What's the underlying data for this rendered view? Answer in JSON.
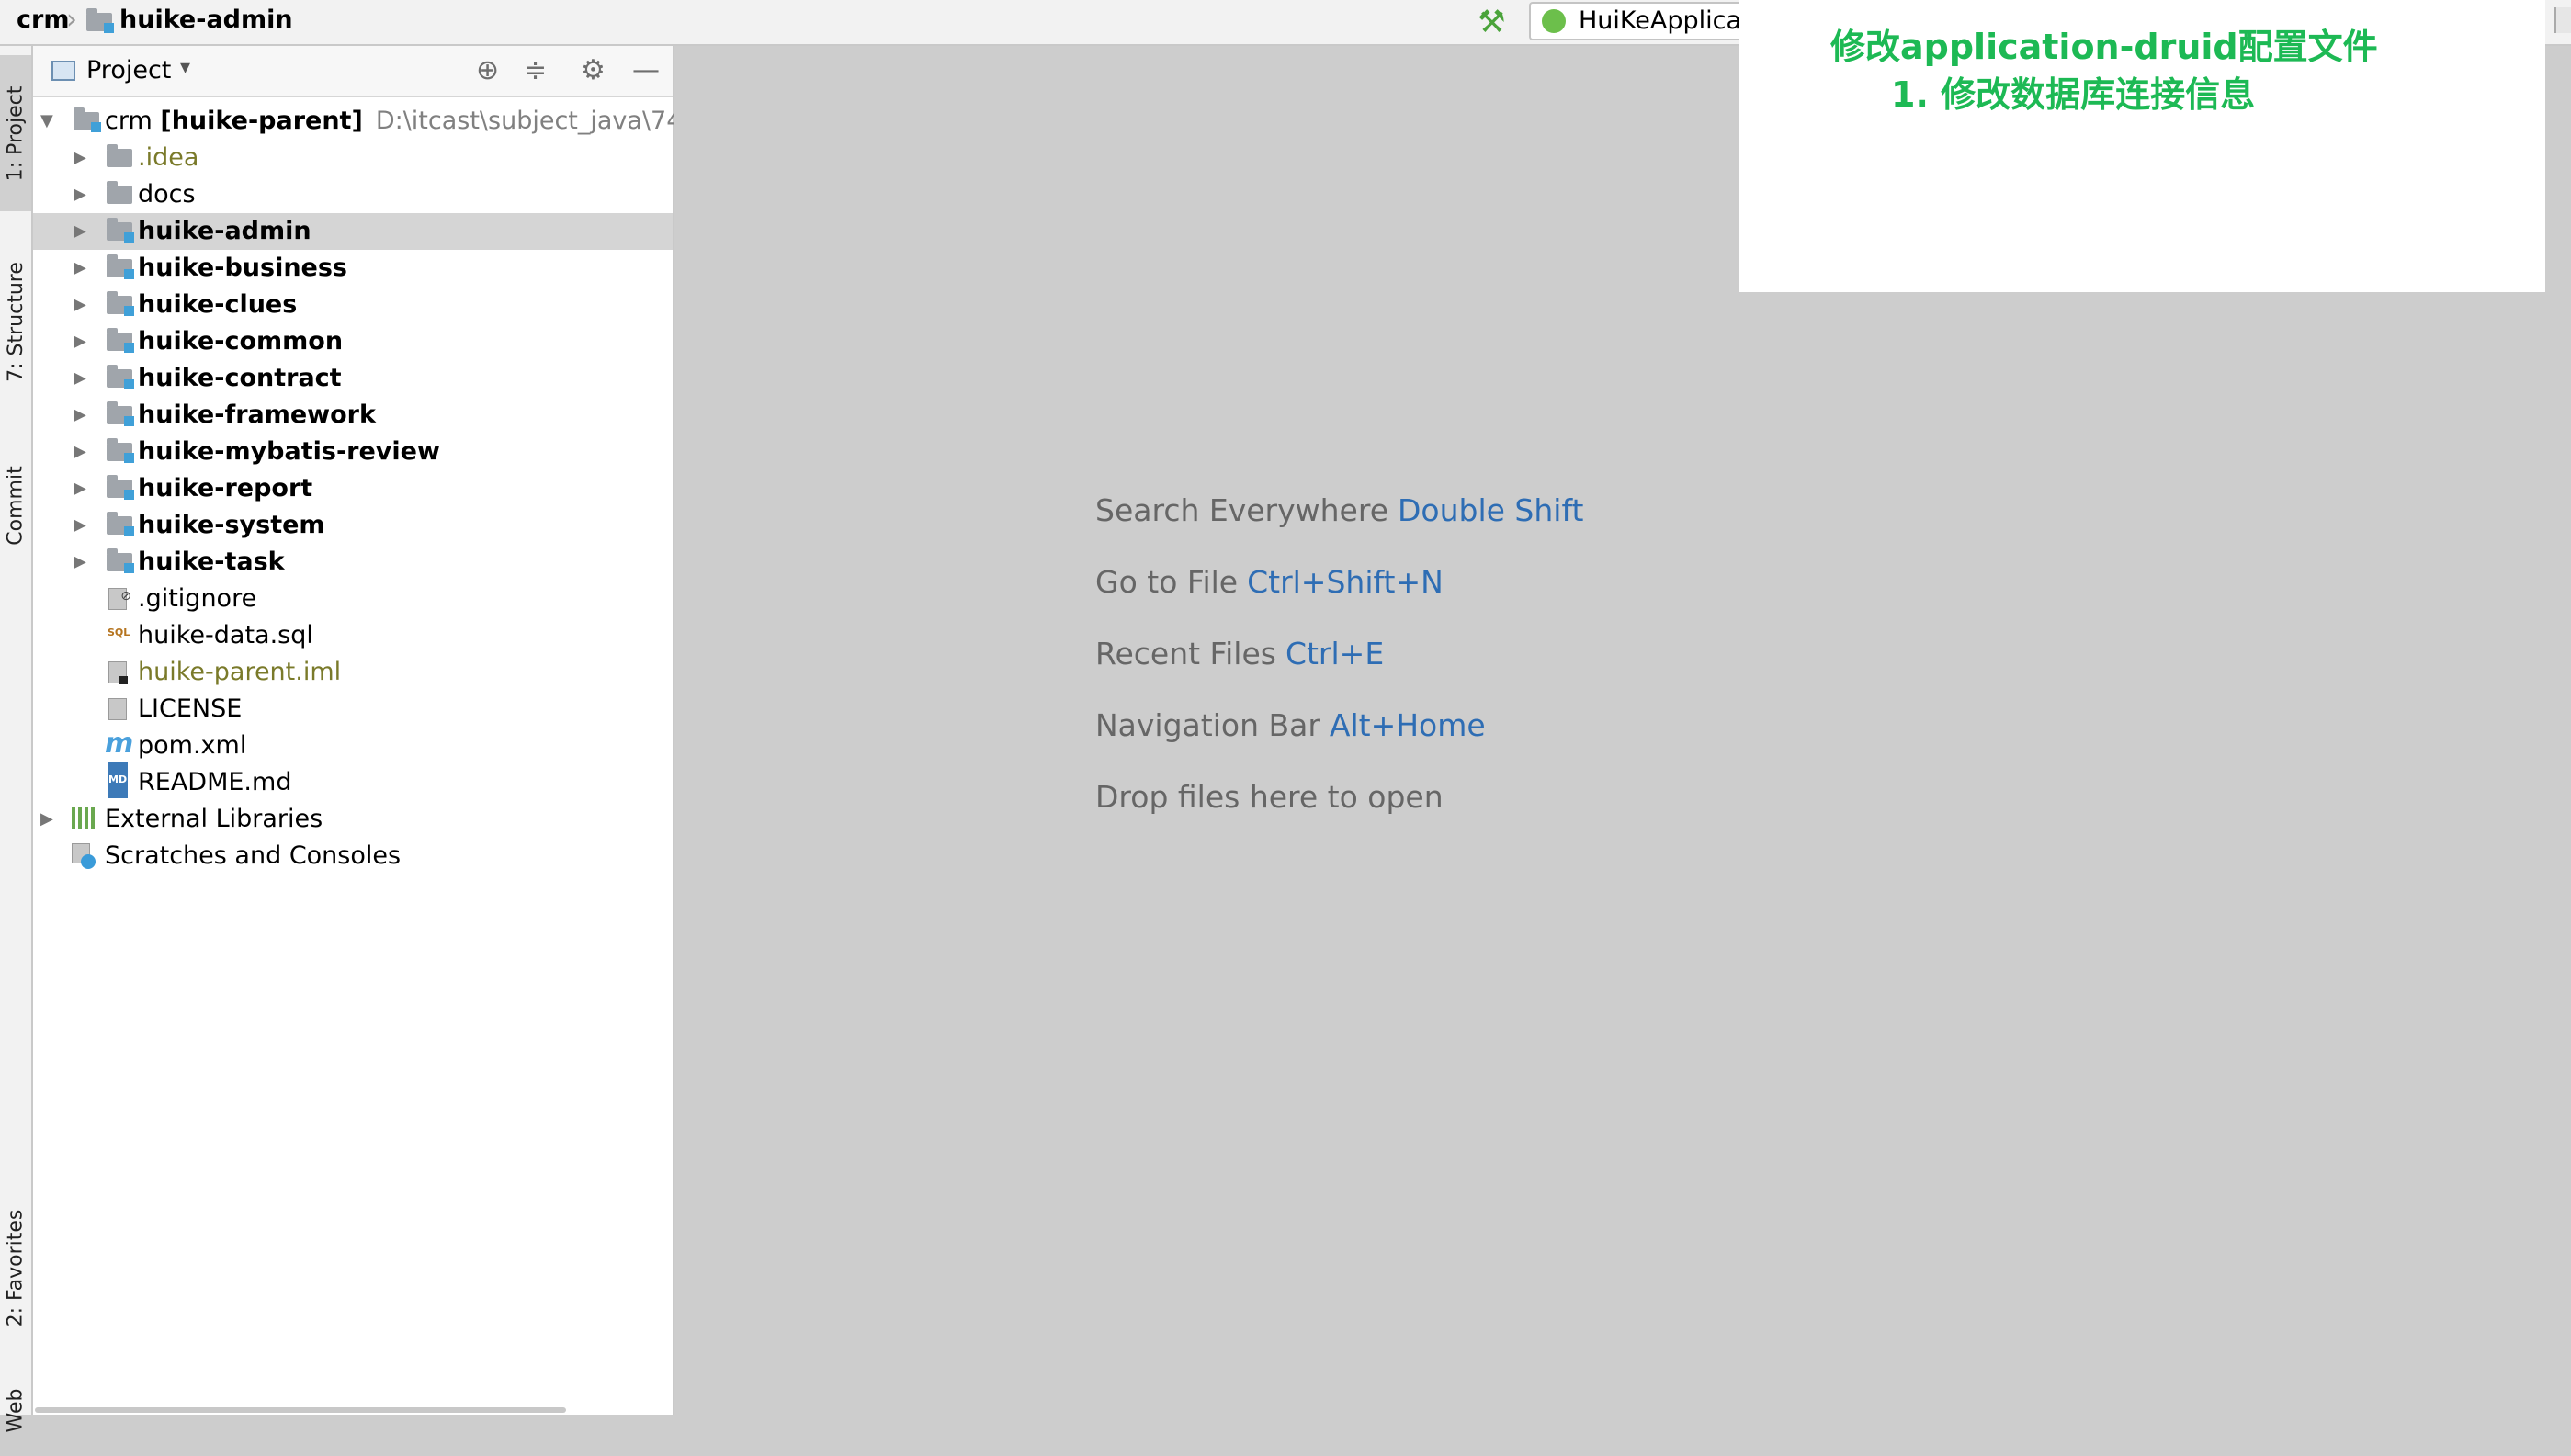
{
  "breadcrumb": {
    "root": "crm",
    "module": "huike-admin"
  },
  "toolbar": {
    "run_config_label": "HuiKeApplica"
  },
  "left_strip": {
    "tabs": [
      "1: Project",
      "7: Structure",
      "Commit",
      "2: Favorites",
      "Web"
    ]
  },
  "project_panel": {
    "title": "Project",
    "dropdown_glyph": "▾",
    "header_icons": {
      "locate": "⊕",
      "collapse": "≑",
      "settings": "⚙",
      "hide": "—"
    }
  },
  "tree": {
    "root": {
      "name": "crm",
      "project": "[huike-parent]",
      "path": "D:\\itcast\\subject_java\\74\\cod"
    },
    "folders": [
      ".idea",
      "docs"
    ],
    "modules": [
      "huike-admin",
      "huike-business",
      "huike-clues",
      "huike-common",
      "huike-contract",
      "huike-framework",
      "huike-mybatis-review",
      "huike-report",
      "huike-system",
      "huike-task"
    ],
    "files": [
      ".gitignore",
      "huike-data.sql",
      "huike-parent.iml",
      "LICENSE",
      "pom.xml",
      "README.md"
    ],
    "external_libraries": "External Libraries",
    "scratches": "Scratches and Consoles",
    "selected": "huike-admin"
  },
  "editor_hints": [
    {
      "text": "Search Everywhere",
      "key": "Double Shift"
    },
    {
      "text": "Go to File",
      "key": "Ctrl+Shift+N"
    },
    {
      "text": "Recent Files",
      "key": "Ctrl+E"
    },
    {
      "text": "Navigation Bar",
      "key": "Alt+Home"
    },
    {
      "text": "Drop files here to open",
      "key": ""
    }
  ],
  "note": {
    "line1": "修改application-druid配置文件",
    "line2": "1. 修改数据库连接信息",
    "color": "#1db954"
  },
  "colors": {
    "accent_blue": "#2e6db4",
    "module_badge": "#40a0d8",
    "selection": "#d5d5d5"
  }
}
